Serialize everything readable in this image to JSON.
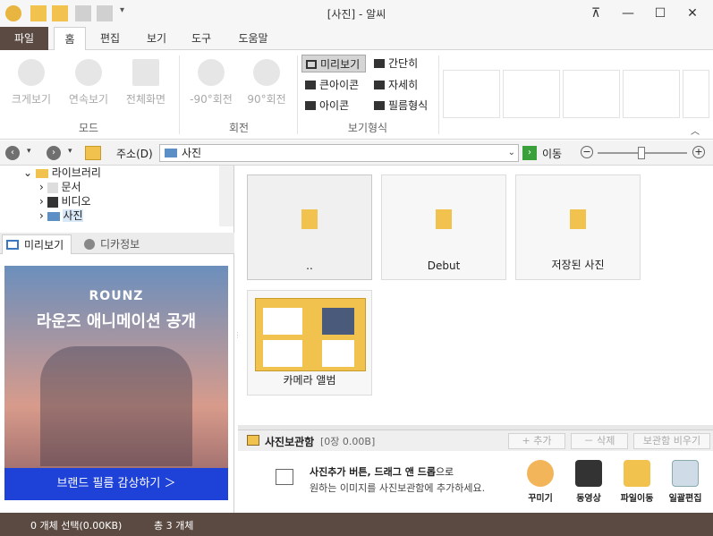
{
  "title": "[사진] - 알씨",
  "colors": {
    "accent": "#5b4a42",
    "cta": "#1e41d8",
    "folder": "#f2c24f"
  },
  "tabs": [
    {
      "label": "파일"
    },
    {
      "label": "홈"
    },
    {
      "label": "편집"
    },
    {
      "label": "보기"
    },
    {
      "label": "도구"
    },
    {
      "label": "도움말"
    }
  ],
  "ribbon": {
    "mode": {
      "items": [
        {
          "label": "크게보기",
          "icon": "zoom-icon"
        },
        {
          "label": "연속보기",
          "icon": "play-icon"
        },
        {
          "label": "전체화면",
          "icon": "fullscreen-icon"
        }
      ],
      "group": "모드"
    },
    "rotate": {
      "items": [
        {
          "label": "-90°회전",
          "icon": "rotate-left-icon"
        },
        {
          "label": "90°회전",
          "icon": "rotate-right-icon"
        }
      ],
      "group": "회전"
    },
    "view": {
      "items": [
        {
          "label": "미리보기"
        },
        {
          "label": "간단히"
        },
        {
          "label": "큰아이콘"
        },
        {
          "label": "자세히"
        },
        {
          "label": "아이콘"
        },
        {
          "label": "필름형식"
        }
      ],
      "group": "보기형식"
    }
  },
  "address": {
    "label": "주소(D)",
    "value": "사진",
    "go": "이동"
  },
  "tree": [
    {
      "label": "라이브러리"
    },
    {
      "label": "문서"
    },
    {
      "label": "비디오"
    },
    {
      "label": "사진"
    }
  ],
  "panel_tabs": [
    {
      "label": "미리보기"
    },
    {
      "label": "디카정보"
    }
  ],
  "ad": {
    "brand": "ROUNZ",
    "headline": "라운즈 애니메이션 공개",
    "cta": "브랜드 필름 감상하기 ＞"
  },
  "files": [
    {
      "label": ".."
    },
    {
      "label": "Debut"
    },
    {
      "label": "저장된 사진"
    },
    {
      "label": "카메라 앨범"
    }
  ],
  "photobox": {
    "title": "사진보관함",
    "count": "[0장 0.00B]",
    "add": "+ 추가",
    "delete": "－ 삭제",
    "clear": "보관함 비우기",
    "hint_bold": "사진추가 버튼, 드래그 앤 드롭",
    "hint_rest": "으로",
    "hint2": "원하는 이미지를 사진보관함에 추가하세요.",
    "actions": [
      {
        "label": "꾸미기",
        "icon": "palette-icon"
      },
      {
        "label": "동영상",
        "icon": "film-icon"
      },
      {
        "label": "파일이동",
        "icon": "folder-move-icon"
      },
      {
        "label": "일괄편집",
        "icon": "batch-edit-icon"
      }
    ]
  },
  "status": {
    "selection": "0 개체 선택(0.00KB)",
    "total": "총 3 개체"
  }
}
